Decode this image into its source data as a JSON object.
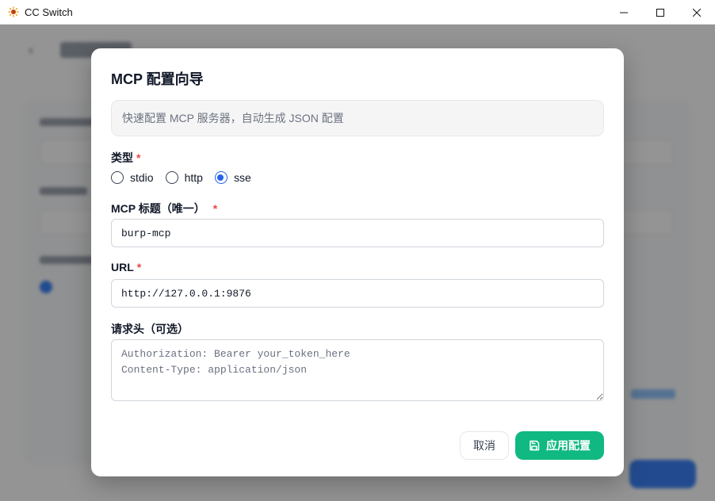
{
  "window": {
    "title": "CC Switch",
    "controls": [
      "minimize",
      "maximize",
      "close"
    ]
  },
  "background": {
    "back_icon": "arrow-left-icon"
  },
  "dialog": {
    "title": "MCP 配置向导",
    "hint_placeholder": "快速配置 MCP 服务器，自动生成 JSON 配置",
    "type_field": {
      "label": "类型",
      "required_mark": "*",
      "options": [
        "stdio",
        "http",
        "sse"
      ],
      "selected": "sse"
    },
    "title_field": {
      "label": "MCP 标题（唯一）",
      "required_mark": "*",
      "value": "burp-mcp"
    },
    "url_field": {
      "label": "URL",
      "required_mark": "*",
      "value": "http://127.0.0.1:9876"
    },
    "headers_field": {
      "label": "请求头（可选）",
      "placeholder": "Authorization: Bearer your_token_here\nContent-Type: application/json"
    },
    "buttons": {
      "cancel": "取消",
      "apply": "应用配置"
    }
  },
  "colors": {
    "accent": "#10b981",
    "radio_selected": "#2563eb",
    "required": "#ef4444"
  }
}
